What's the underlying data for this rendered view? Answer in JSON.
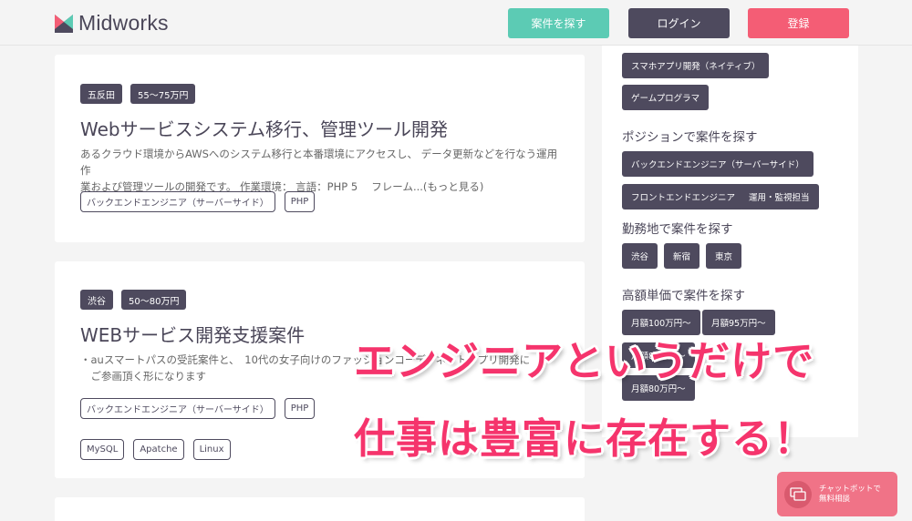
{
  "header": {
    "logo_text": "Midworks",
    "search_button": "案件を探す",
    "login_button": "ログイン",
    "signup_button": "登録"
  },
  "jobs": [
    {
      "location": "五反田",
      "price": "55〜75万円",
      "title": "Webサービスシステム移行、管理ツール開発",
      "desc_line1": "あるクラウド環境からAWSへのシステム移行と本番環境にアクセスし、 データ更新などを行なう運用作",
      "desc_line2": "業および管理ツールの開発です。 作業環境： 言語：PHP 5　 フレーム...(もっと見る)",
      "tags": [
        "バックエンドエンジニア（サーバーサイド）",
        "PHP"
      ]
    },
    {
      "location": "渋谷",
      "price": "50〜80万円",
      "title": "WEBサービス開発支援案件",
      "desc_line1": "・auスマートパスの受託案件と、　10代の女子向けのファッションコーディネートアプリ開発に",
      "desc_line2": "　ご参画頂く形になります",
      "tags": [
        "バックエンドエンジニア（サーバーサイド）",
        "PHP",
        "MySQL",
        "Apatche",
        "Linux"
      ]
    }
  ],
  "sidebar": {
    "skills": [
      "スマホアプリ開発（ネイティブ）",
      "ゲームプログラマ"
    ],
    "position_heading": "ポジションで案件を探す",
    "positions": [
      "バックエンドエンジニア（サーバーサイド）",
      "フロントエンドエンジニア",
      "運用・監視担当"
    ],
    "location_heading": "勤務地で案件を探す",
    "locations": [
      "渋谷",
      "新宿",
      "東京"
    ],
    "price_heading": "高額単価で案件を探す",
    "prices": [
      "月額100万円〜",
      "月額95万円〜",
      "月額85万円〜",
      "月額80万円〜"
    ]
  },
  "overlay": {
    "line1": "エンジニアというだけで",
    "line2": "仕事は豊富に存在する！"
  },
  "chat": {
    "line1": "チャットボットで",
    "line2": "無料相談"
  },
  "colors": {
    "accent_teal": "#5ccbb4",
    "dark": "#4e4a5e",
    "brand_pink": "#f45d75",
    "overlay_pink": "#f5346c"
  },
  "icons": [
    "logo-mark-icon",
    "chat-bubble-icon"
  ]
}
